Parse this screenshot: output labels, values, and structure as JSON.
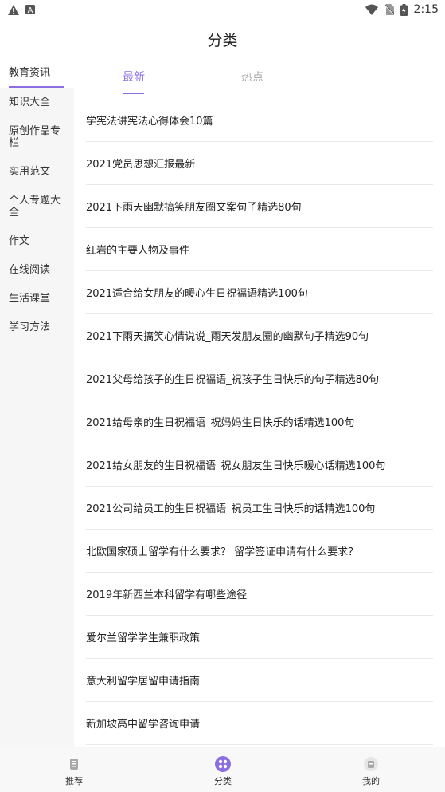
{
  "status_bar": {
    "time": "2:15",
    "left_icons": [
      "warning-icon",
      "a-icon"
    ],
    "right_icons": [
      "wifi-icon",
      "no-sim-icon",
      "battery-charging-icon"
    ]
  },
  "page": {
    "title": "分类"
  },
  "sidebar": {
    "items": [
      {
        "label": "教育资讯",
        "active": true
      },
      {
        "label": "知识大全"
      },
      {
        "label": "原创作品专栏"
      },
      {
        "label": "实用范文"
      },
      {
        "label": "个人专题大全"
      },
      {
        "label": "作文"
      },
      {
        "label": "在线阅读"
      },
      {
        "label": "生活课堂"
      },
      {
        "label": "学习方法"
      }
    ]
  },
  "tabs": {
    "newest": "最新",
    "hot": "热点"
  },
  "articles": [
    "学宪法讲宪法心得体会10篇",
    "2021党员思想汇报最新",
    "2021下雨天幽默搞笑朋友圈文案句子精选80句",
    "红岩的主要人物及事件",
    "2021适合给女朋友的暖心生日祝福语精选100句",
    "2021下雨天搞笑心情说说_雨天发朋友圈的幽默句子精选90句",
    "2021父母给孩子的生日祝福语_祝孩子生日快乐的句子精选80句",
    "2021给母亲的生日祝福语_祝妈妈生日快乐的话精选100句",
    "2021给女朋友的生日祝福语_祝女朋友生日快乐暖心话精选100句",
    "2021公司给员工的生日祝福语_祝员工生日快乐的话精选100句",
    "北欧国家硕士留学有什么要求？ 留学签证申请有什么要求？",
    "2019年新西兰本科留学有哪些途径",
    "爱尔兰留学学生兼职政策",
    "意大利留学居留申请指南",
    "新加坡高中留学咨询申请"
  ],
  "bottom_nav": {
    "recommend": "推荐",
    "category": "分类",
    "mine": "我的"
  },
  "colors": {
    "accent": "#8b6fe0",
    "sidebar_bg": "#f6f6f6",
    "divider": "#e8e8e8"
  }
}
